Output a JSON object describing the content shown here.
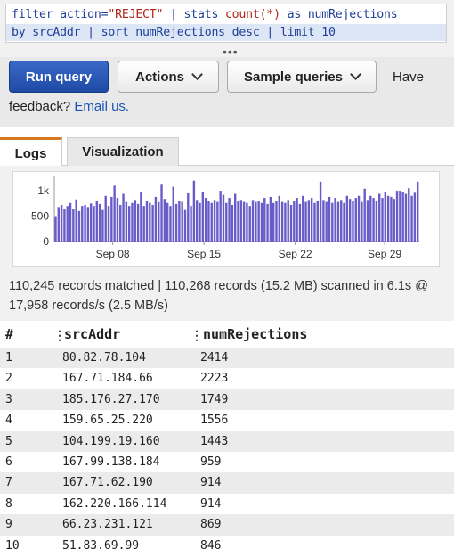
{
  "query": {
    "line1": [
      {
        "t": "filter action=",
        "c": "kw"
      },
      {
        "t": "\"REJECT\"",
        "c": "str"
      },
      {
        "t": " | stats ",
        "c": "kw"
      },
      {
        "t": "count(*)",
        "c": "fn"
      },
      {
        "t": " as numRejections",
        "c": "kw"
      }
    ],
    "line2": "by srcAddr | sort numRejections desc | limit 10",
    "grip": "•••"
  },
  "toolbar": {
    "run_label": "Run query",
    "actions_label": "Actions",
    "samples_label": "Sample queries",
    "have": "Have",
    "feedback_prefix": "feedback?",
    "email_link": "Email us."
  },
  "tabs": {
    "logs": "Logs",
    "visualization": "Visualization"
  },
  "chart_data": {
    "type": "bar",
    "y_ticks": [
      "1k",
      "500",
      "0"
    ],
    "ylim": [
      0,
      1300
    ],
    "x_ticks": [
      "Sep 08",
      "Sep 15",
      "Sep 22",
      "Sep 29"
    ],
    "bar_color": "#6a5cc8",
    "values": [
      500,
      680,
      720,
      650,
      700,
      760,
      640,
      830,
      600,
      700,
      720,
      680,
      750,
      700,
      800,
      740,
      620,
      900,
      700,
      880,
      1100,
      860,
      720,
      940,
      780,
      700,
      760,
      820,
      740,
      980,
      700,
      800,
      760,
      720,
      880,
      780,
      1120,
      840,
      760,
      700,
      1080,
      740,
      800,
      780,
      620,
      950,
      700,
      1200,
      820,
      760,
      980,
      860,
      800,
      760,
      820,
      780,
      1000,
      920,
      760,
      860,
      720,
      940,
      800,
      820,
      780,
      760,
      700,
      820,
      780,
      800,
      760,
      860,
      740,
      880,
      760,
      800,
      900,
      780,
      760,
      820,
      720,
      800,
      860,
      740,
      900,
      780,
      820,
      860,
      760,
      800,
      1180,
      820,
      780,
      880,
      760,
      860,
      780,
      820,
      760,
      900,
      840,
      800,
      860,
      900,
      780,
      1040,
      820,
      900,
      860,
      800,
      940,
      860,
      980,
      900,
      880,
      840,
      1000,
      1000,
      980,
      940,
      1050,
      900,
      960,
      1180
    ]
  },
  "summary": "110,245 records matched | 110,268 records (15.2 MB) scanned in 6.1s @ 17,958 records/s (2.5 MB/s)",
  "table": {
    "headers": {
      "num": "#",
      "addr": "srcAddr",
      "rej": "numRejections"
    },
    "separator": "⋮",
    "rows": [
      {
        "num": "1",
        "addr": "80.82.78.104",
        "rej": "2414"
      },
      {
        "num": "2",
        "addr": "167.71.184.66",
        "rej": "2223"
      },
      {
        "num": "3",
        "addr": "185.176.27.170",
        "rej": "1749"
      },
      {
        "num": "4",
        "addr": "159.65.25.220",
        "rej": "1556"
      },
      {
        "num": "5",
        "addr": "104.199.19.160",
        "rej": "1443"
      },
      {
        "num": "6",
        "addr": "167.99.138.184",
        "rej": "959"
      },
      {
        "num": "7",
        "addr": "167.71.62.190",
        "rej": "914"
      },
      {
        "num": "8",
        "addr": "162.220.166.114",
        "rej": "914"
      },
      {
        "num": "9",
        "addr": "66.23.231.121",
        "rej": "869"
      },
      {
        "num": "10",
        "addr": "51.83.69.99",
        "rej": "846"
      }
    ]
  }
}
